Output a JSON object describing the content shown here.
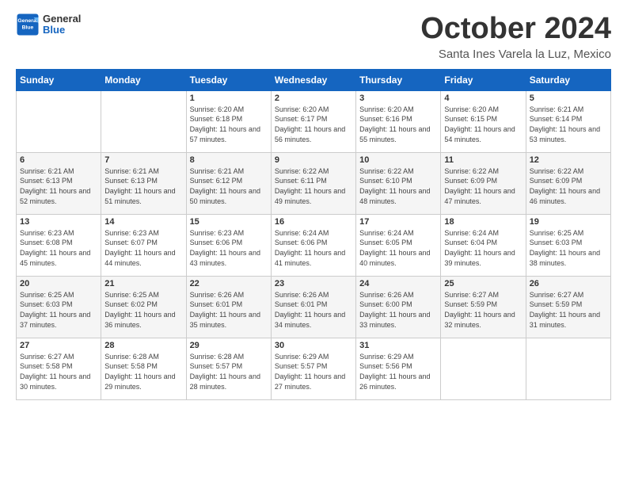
{
  "logo": {
    "line1": "General",
    "line2": "Blue"
  },
  "title": "October 2024",
  "location": "Santa Ines Varela la Luz, Mexico",
  "days_header": [
    "Sunday",
    "Monday",
    "Tuesday",
    "Wednesday",
    "Thursday",
    "Friday",
    "Saturday"
  ],
  "weeks": [
    [
      {
        "day": "",
        "info": ""
      },
      {
        "day": "",
        "info": ""
      },
      {
        "day": "1",
        "info": "Sunrise: 6:20 AM\nSunset: 6:18 PM\nDaylight: 11 hours\nand 57 minutes."
      },
      {
        "day": "2",
        "info": "Sunrise: 6:20 AM\nSunset: 6:17 PM\nDaylight: 11 hours\nand 56 minutes."
      },
      {
        "day": "3",
        "info": "Sunrise: 6:20 AM\nSunset: 6:16 PM\nDaylight: 11 hours\nand 55 minutes."
      },
      {
        "day": "4",
        "info": "Sunrise: 6:20 AM\nSunset: 6:15 PM\nDaylight: 11 hours\nand 54 minutes."
      },
      {
        "day": "5",
        "info": "Sunrise: 6:21 AM\nSunset: 6:14 PM\nDaylight: 11 hours\nand 53 minutes."
      }
    ],
    [
      {
        "day": "6",
        "info": "Sunrise: 6:21 AM\nSunset: 6:13 PM\nDaylight: 11 hours\nand 52 minutes."
      },
      {
        "day": "7",
        "info": "Sunrise: 6:21 AM\nSunset: 6:13 PM\nDaylight: 11 hours\nand 51 minutes."
      },
      {
        "day": "8",
        "info": "Sunrise: 6:21 AM\nSunset: 6:12 PM\nDaylight: 11 hours\nand 50 minutes."
      },
      {
        "day": "9",
        "info": "Sunrise: 6:22 AM\nSunset: 6:11 PM\nDaylight: 11 hours\nand 49 minutes."
      },
      {
        "day": "10",
        "info": "Sunrise: 6:22 AM\nSunset: 6:10 PM\nDaylight: 11 hours\nand 48 minutes."
      },
      {
        "day": "11",
        "info": "Sunrise: 6:22 AM\nSunset: 6:09 PM\nDaylight: 11 hours\nand 47 minutes."
      },
      {
        "day": "12",
        "info": "Sunrise: 6:22 AM\nSunset: 6:09 PM\nDaylight: 11 hours\nand 46 minutes."
      }
    ],
    [
      {
        "day": "13",
        "info": "Sunrise: 6:23 AM\nSunset: 6:08 PM\nDaylight: 11 hours\nand 45 minutes."
      },
      {
        "day": "14",
        "info": "Sunrise: 6:23 AM\nSunset: 6:07 PM\nDaylight: 11 hours\nand 44 minutes."
      },
      {
        "day": "15",
        "info": "Sunrise: 6:23 AM\nSunset: 6:06 PM\nDaylight: 11 hours\nand 43 minutes."
      },
      {
        "day": "16",
        "info": "Sunrise: 6:24 AM\nSunset: 6:06 PM\nDaylight: 11 hours\nand 41 minutes."
      },
      {
        "day": "17",
        "info": "Sunrise: 6:24 AM\nSunset: 6:05 PM\nDaylight: 11 hours\nand 40 minutes."
      },
      {
        "day": "18",
        "info": "Sunrise: 6:24 AM\nSunset: 6:04 PM\nDaylight: 11 hours\nand 39 minutes."
      },
      {
        "day": "19",
        "info": "Sunrise: 6:25 AM\nSunset: 6:03 PM\nDaylight: 11 hours\nand 38 minutes."
      }
    ],
    [
      {
        "day": "20",
        "info": "Sunrise: 6:25 AM\nSunset: 6:03 PM\nDaylight: 11 hours\nand 37 minutes."
      },
      {
        "day": "21",
        "info": "Sunrise: 6:25 AM\nSunset: 6:02 PM\nDaylight: 11 hours\nand 36 minutes."
      },
      {
        "day": "22",
        "info": "Sunrise: 6:26 AM\nSunset: 6:01 PM\nDaylight: 11 hours\nand 35 minutes."
      },
      {
        "day": "23",
        "info": "Sunrise: 6:26 AM\nSunset: 6:01 PM\nDaylight: 11 hours\nand 34 minutes."
      },
      {
        "day": "24",
        "info": "Sunrise: 6:26 AM\nSunset: 6:00 PM\nDaylight: 11 hours\nand 33 minutes."
      },
      {
        "day": "25",
        "info": "Sunrise: 6:27 AM\nSunset: 5:59 PM\nDaylight: 11 hours\nand 32 minutes."
      },
      {
        "day": "26",
        "info": "Sunrise: 6:27 AM\nSunset: 5:59 PM\nDaylight: 11 hours\nand 31 minutes."
      }
    ],
    [
      {
        "day": "27",
        "info": "Sunrise: 6:27 AM\nSunset: 5:58 PM\nDaylight: 11 hours\nand 30 minutes."
      },
      {
        "day": "28",
        "info": "Sunrise: 6:28 AM\nSunset: 5:58 PM\nDaylight: 11 hours\nand 29 minutes."
      },
      {
        "day": "29",
        "info": "Sunrise: 6:28 AM\nSunset: 5:57 PM\nDaylight: 11 hours\nand 28 minutes."
      },
      {
        "day": "30",
        "info": "Sunrise: 6:29 AM\nSunset: 5:57 PM\nDaylight: 11 hours\nand 27 minutes."
      },
      {
        "day": "31",
        "info": "Sunrise: 6:29 AM\nSunset: 5:56 PM\nDaylight: 11 hours\nand 26 minutes."
      },
      {
        "day": "",
        "info": ""
      },
      {
        "day": "",
        "info": ""
      }
    ]
  ]
}
